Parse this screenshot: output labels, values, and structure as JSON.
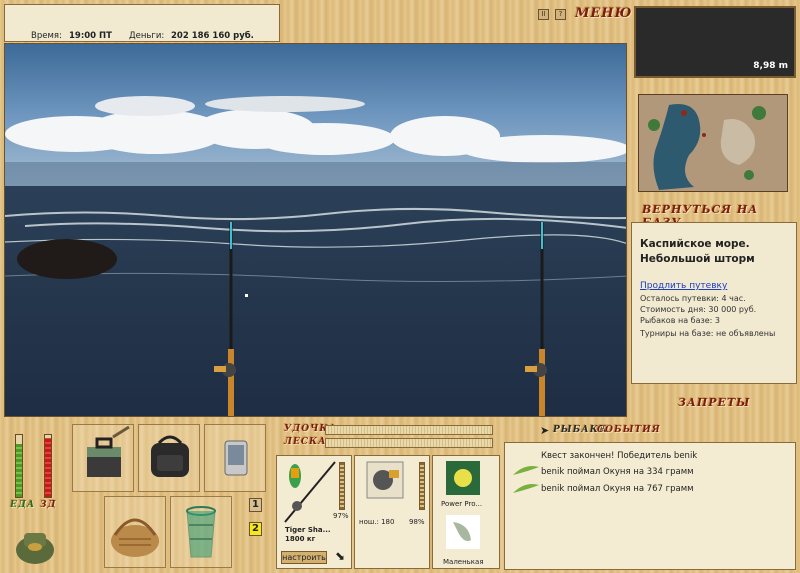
{
  "header": {
    "time_label": "Время:",
    "time_value": "19:00 ПТ",
    "money_label": "Деньги:",
    "money_value": "202 186 160 руб.",
    "menu_label": "МЕНЮ",
    "pause_symbol": "II",
    "help_symbol": "?"
  },
  "depth": {
    "value": "8,98 m"
  },
  "navigation": {
    "return_label": "ВЕРНУТЬСЯ НА БАЗУ",
    "bans_label": "ЗАПРЕТЫ"
  },
  "location": {
    "title": "Каспийское море. Небольшой шторм",
    "extend_link": "Продлить путевку",
    "remaining": "Осталось путевки: 4 час.",
    "day_cost": "Стоимость дня: 30 000 руб.",
    "anglers": "Рыбаков на базе: 3",
    "tournaments": "Турниры на базе: не объявлены"
  },
  "status": {
    "food_label": "ЕДА",
    "hp_label": "ЗД",
    "food_level": 0.85,
    "health_level": 0.95
  },
  "gear": {
    "rod_label": "УДОЧКА",
    "line_label": "ЛЕСКА",
    "rod_name": "Tiger Sha...",
    "rod_weight": "1800 кг",
    "rod_percent": "97%",
    "reel_label": "нош.: 180",
    "reel_percent": "98%",
    "line_name": "Power Pro...",
    "bait_name": "Маленькая",
    "configure_label": "настроить"
  },
  "slots": {
    "page1": "1",
    "page2": "2"
  },
  "events": {
    "tab_anglers": "РЫБАКИ",
    "tab_events": "СОБЫТИЯ",
    "items": [
      "Квест закончен! Победитель benik",
      "benik поймал Окуня на 334 грамм",
      "benik поймал Окуня на 767 грамм"
    ]
  },
  "colors": {
    "accent_red": "#7a1c10",
    "link_blue": "#1a3cc4",
    "health_red": "#c81818",
    "food_green": "#4c9a2a"
  }
}
